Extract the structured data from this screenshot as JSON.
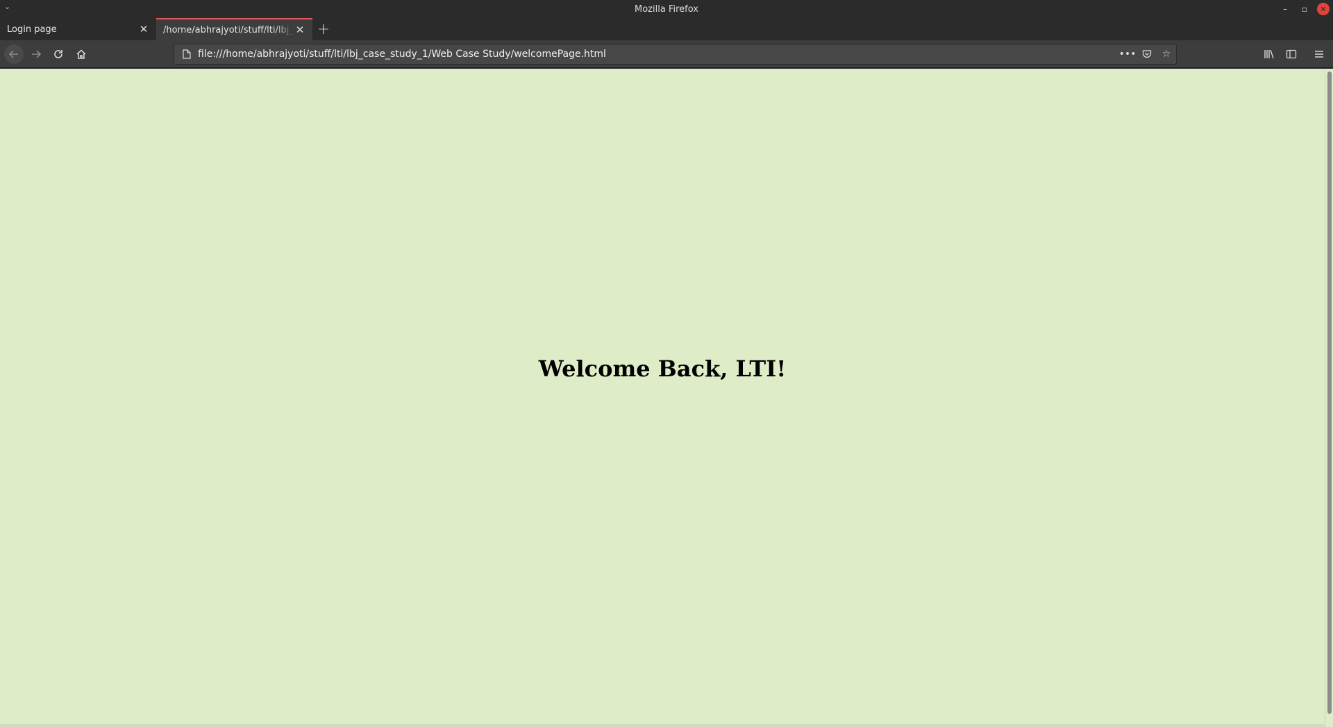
{
  "window": {
    "title": "Mozilla Firefox",
    "controls": {
      "minimize": "–",
      "maximize": "▫",
      "close": "✕"
    }
  },
  "tabs": [
    {
      "label": "Login page",
      "active": false
    },
    {
      "label": "/home/abhrajyoti/stuff/lti/lbj_",
      "active": true
    }
  ],
  "navbar": {
    "url": "file:///home/abhrajyoti/stuff/lti/lbj_case_study_1/Web Case Study/welcomePage.html",
    "icons": [
      "back-icon",
      "forward-icon",
      "reload-icon",
      "home-icon",
      "page-icon",
      "more-icon",
      "pocket-icon",
      "bookmark-star-icon",
      "library-icon",
      "sidebar-icon",
      "menu-icon"
    ]
  },
  "page": {
    "heading": "Welcome Back, LTI!",
    "background_color": "#deedc8"
  },
  "colors": {
    "chrome_dark": "#2b2b2b",
    "toolbar": "#3d3d3d",
    "active_tab_accent": "#e25858"
  }
}
